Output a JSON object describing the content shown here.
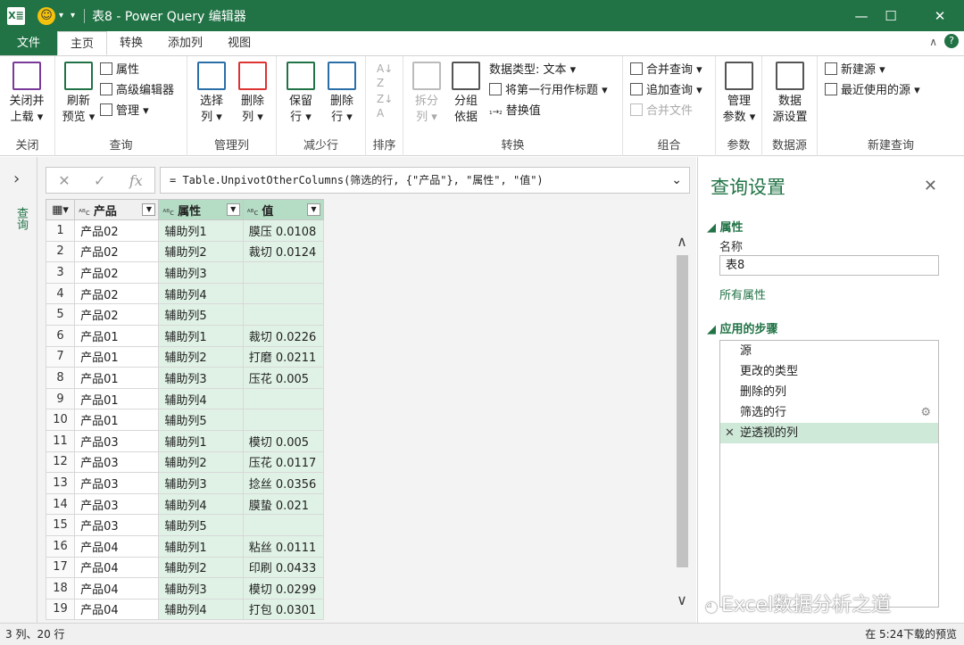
{
  "window": {
    "title": "表8 - Power Query 编辑器",
    "app_icon": "X≣",
    "minimize": "—",
    "maximize": "☐",
    "close": "✕"
  },
  "tabs": [
    "文件",
    "主页",
    "转换",
    "添加列",
    "视图"
  ],
  "ribbon": {
    "close_group": {
      "label": "关闭",
      "btn1": "关闭并",
      "btn2": "上载 ▾"
    },
    "query_group": {
      "label": "查询",
      "refresh1": "刷新",
      "refresh2": "预览 ▾",
      "properties": "属性",
      "advanced": "高级编辑器",
      "manage": "管理 ▾"
    },
    "manage_cols": {
      "label": "管理列",
      "choose1": "选择",
      "choose2": "列 ▾",
      "remove1": "删除",
      "remove2": "列 ▾"
    },
    "reduce_rows": {
      "label": "减少行",
      "keep1": "保留",
      "keep2": "行 ▾",
      "remove1": "删除",
      "remove2": "行 ▾"
    },
    "sort": {
      "label": "排序"
    },
    "transform": {
      "label": "转换",
      "split1": "拆分",
      "split2": "列 ▾",
      "group1": "分组",
      "group2": "依据",
      "datatype": "数据类型: 文本 ▾",
      "first_row": "将第一行用作标题 ▾",
      "replace": "替换值"
    },
    "combine": {
      "label": "组合",
      "merge": "合并查询 ▾",
      "append": "追加查询 ▾",
      "files": "合并文件"
    },
    "params": {
      "label": "参数",
      "manage1": "管理",
      "manage2": "参数 ▾"
    },
    "datasource": {
      "label": "数据源",
      "btn1": "数据",
      "btn2": "源设置"
    },
    "newquery": {
      "label": "新建查询",
      "new_source": "新建源 ▾",
      "recent": "最近使用的源 ▾"
    }
  },
  "leftpane": {
    "label": "查询",
    "toggle": "›"
  },
  "formula": "= Table.UnpivotOtherColumns(筛选的行, {\"产品\"}, \"属性\", \"值\")",
  "columns": [
    "产品",
    "属性",
    "值"
  ],
  "rows": [
    [
      "1",
      "产品02",
      "辅助列1",
      "膜压 0.0108"
    ],
    [
      "2",
      "产品02",
      "辅助列2",
      "裁切 0.0124"
    ],
    [
      "3",
      "产品02",
      "辅助列3",
      ""
    ],
    [
      "4",
      "产品02",
      "辅助列4",
      ""
    ],
    [
      "5",
      "产品02",
      "辅助列5",
      ""
    ],
    [
      "6",
      "产品01",
      "辅助列1",
      "裁切 0.0226"
    ],
    [
      "7",
      "产品01",
      "辅助列2",
      "打磨 0.0211"
    ],
    [
      "8",
      "产品01",
      "辅助列3",
      "压花 0.005"
    ],
    [
      "9",
      "产品01",
      "辅助列4",
      ""
    ],
    [
      "10",
      "产品01",
      "辅助列5",
      ""
    ],
    [
      "11",
      "产品03",
      "辅助列1",
      "模切 0.005"
    ],
    [
      "12",
      "产品03",
      "辅助列2",
      "压花 0.0117"
    ],
    [
      "13",
      "产品03",
      "辅助列3",
      "捻丝 0.0356"
    ],
    [
      "14",
      "产品03",
      "辅助列4",
      "膜蛰 0.021"
    ],
    [
      "15",
      "产品03",
      "辅助列5",
      ""
    ],
    [
      "16",
      "产品04",
      "辅助列1",
      "粘丝 0.0111"
    ],
    [
      "17",
      "产品04",
      "辅助列2",
      "印刷 0.0433"
    ],
    [
      "18",
      "产品04",
      "辅助列3",
      "模切 0.0299"
    ],
    [
      "19",
      "产品04",
      "辅助列4",
      "打包 0.0301"
    ]
  ],
  "settings": {
    "title": "查询设置",
    "props_header": "◢ 属性",
    "name_label": "名称",
    "name_value": "表8",
    "all_props": "所有属性",
    "steps_header": "◢ 应用的步骤",
    "steps": [
      "源",
      "更改的类型",
      "删除的列",
      "筛选的行",
      "逆透视的列"
    ]
  },
  "status": {
    "left": "3 列、20 行",
    "right": "在 5:24下载的预览"
  },
  "watermark": "Excel数据分析之道"
}
